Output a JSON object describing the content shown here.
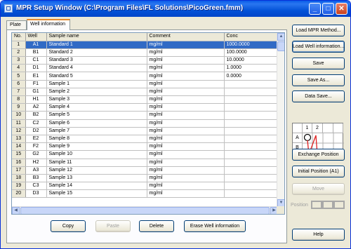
{
  "window": {
    "title": "MPR Setup Window (C:\\Program Files\\FL Solutions\\PicoGreen.fmm)",
    "min_glyph": "_",
    "max_glyph": "□",
    "close_glyph": "✕"
  },
  "tabs": [
    {
      "label": "Plate"
    },
    {
      "label": "Well information"
    }
  ],
  "table": {
    "headers": [
      "No.",
      "Well",
      "Sample name",
      "Comment",
      "Conc"
    ],
    "rows": [
      {
        "no": "1",
        "well": "A1",
        "name": "Standard 1",
        "comment": "mg/ml",
        "conc": "1000.0000"
      },
      {
        "no": "2",
        "well": "B1",
        "name": "Standard 2",
        "comment": "mg/ml",
        "conc": "100.0000"
      },
      {
        "no": "3",
        "well": "C1",
        "name": "Standard 3",
        "comment": "mg/ml",
        "conc": "10.0000"
      },
      {
        "no": "4",
        "well": "D1",
        "name": "Standard 4",
        "comment": "mg/ml",
        "conc": "1.0000"
      },
      {
        "no": "5",
        "well": "E1",
        "name": "Standard 5",
        "comment": "mg/ml",
        "conc": "0.0000"
      },
      {
        "no": "6",
        "well": "F1",
        "name": "Sample 1",
        "comment": "mg/ml",
        "conc": ""
      },
      {
        "no": "7",
        "well": "G1",
        "name": "Sample 2",
        "comment": "mg/ml",
        "conc": ""
      },
      {
        "no": "8",
        "well": "H1",
        "name": "Sample 3",
        "comment": "mg/ml",
        "conc": ""
      },
      {
        "no": "9",
        "well": "A2",
        "name": "Sample 4",
        "comment": "mg/ml",
        "conc": ""
      },
      {
        "no": "10",
        "well": "B2",
        "name": "Sample 5",
        "comment": "mg/ml",
        "conc": ""
      },
      {
        "no": "11",
        "well": "C2",
        "name": "Sample 6",
        "comment": "mg/ml",
        "conc": ""
      },
      {
        "no": "12",
        "well": "D2",
        "name": "Sample 7",
        "comment": "mg/ml",
        "conc": ""
      },
      {
        "no": "13",
        "well": "E2",
        "name": "Sample 8",
        "comment": "mg/ml",
        "conc": ""
      },
      {
        "no": "14",
        "well": "F2",
        "name": "Sample 9",
        "comment": "mg/ml",
        "conc": ""
      },
      {
        "no": "15",
        "well": "G2",
        "name": "Sample 10",
        "comment": "mg/ml",
        "conc": ""
      },
      {
        "no": "16",
        "well": "H2",
        "name": "Sample 11",
        "comment": "mg/ml",
        "conc": ""
      },
      {
        "no": "17",
        "well": "A3",
        "name": "Sample 12",
        "comment": "mg/ml",
        "conc": ""
      },
      {
        "no": "18",
        "well": "B3",
        "name": "Sample 13",
        "comment": "mg/ml",
        "conc": ""
      },
      {
        "no": "19",
        "well": "C3",
        "name": "Sample 14",
        "comment": "mg/ml",
        "conc": ""
      },
      {
        "no": "20",
        "well": "D3",
        "name": "Sample 15",
        "comment": "mg/ml",
        "conc": ""
      }
    ],
    "selected_row": 0
  },
  "bottom_buttons": {
    "copy": "Copy",
    "paste": "Paste",
    "delete": "Delete",
    "erase": "Erase Well information"
  },
  "side_buttons": {
    "load_mpr": "Load MPR Method...",
    "load_well": "Load Well information...",
    "save": "Save",
    "save_as": "Save As...",
    "data_save": "Data Save...",
    "exchange": "Exchange Position",
    "initial": "Initial Position (A1)",
    "move": "Move",
    "help": "Help"
  },
  "plate_map": {
    "col_labels": [
      "1",
      "2"
    ],
    "row_labels": [
      "A",
      "B"
    ],
    "arrow_color": "#e02020"
  },
  "position_label": "Position",
  "colors": {
    "selection": "#316ac5",
    "titlebar": "#0a5ce8"
  }
}
